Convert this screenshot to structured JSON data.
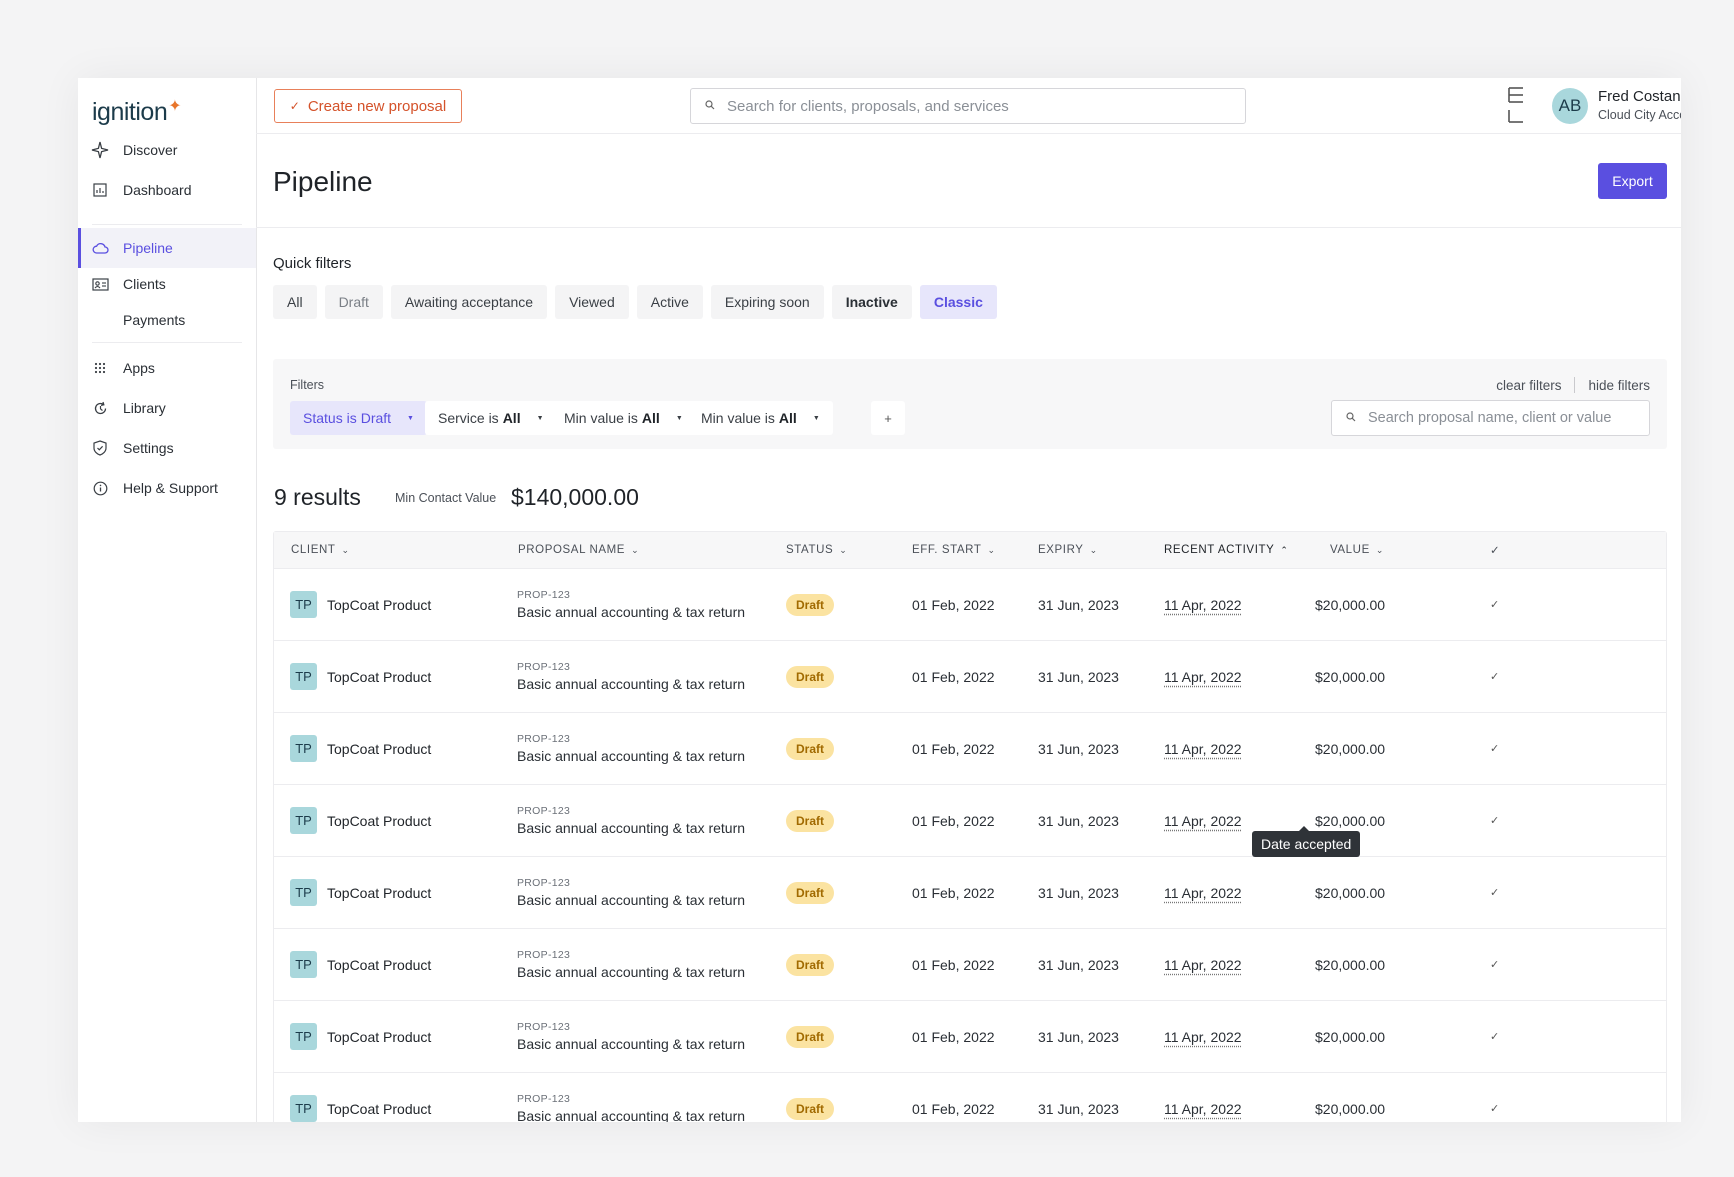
{
  "sidebar": {
    "logo_text": "ignition",
    "items": [
      {
        "label": "Discover",
        "icon": "sparkle-icon"
      },
      {
        "label": "Dashboard",
        "icon": "chart-icon"
      },
      {
        "label": "Pipeline",
        "icon": "cloud-icon",
        "active": true
      },
      {
        "label": "Clients",
        "icon": "id-card-icon"
      },
      {
        "label": "Payments",
        "icon": ""
      },
      {
        "label": "Apps",
        "icon": "grid-icon"
      },
      {
        "label": "Library",
        "icon": "refresh-icon"
      },
      {
        "label": "Settings",
        "icon": "shield-icon"
      },
      {
        "label": "Help & Support",
        "icon": "info-icon"
      }
    ]
  },
  "topbar": {
    "create_label": "Create new proposal",
    "search_placeholder": "Search for clients, proposals, and services",
    "user": {
      "initials": "AB",
      "name": "Fred Costanza",
      "org": "Cloud City Accounting"
    }
  },
  "page": {
    "title": "Pipeline",
    "export_label": "Export"
  },
  "quick_filters": {
    "label": "Quick filters",
    "items": [
      "All",
      "Draft",
      "Awaiting acceptance",
      "Viewed",
      "Active",
      "Expiring soon",
      "Inactive",
      "Classic"
    ],
    "selected": "Classic"
  },
  "filters": {
    "label": "Filters",
    "clear_label": "clear filters",
    "hide_label": "hide filters",
    "search_placeholder": "Search proposal name, client or value",
    "chips": [
      {
        "prefix": "Status is",
        "value": "Draft",
        "active": true
      },
      {
        "prefix": "Service is",
        "value": "All"
      },
      {
        "prefix": "Min value is",
        "value": "All"
      },
      {
        "prefix": "Min value is",
        "value": "All"
      }
    ],
    "add_label": "+"
  },
  "results": {
    "count_label": "9 results",
    "min_label": "Min Contact Value",
    "min_value": "$140,000.00"
  },
  "table": {
    "columns": [
      "CLIENT",
      "PROPOSAL NAME",
      "STATUS",
      "EFF. START",
      "EXPIRY",
      "RECENT ACTIVITY",
      "VALUE"
    ],
    "rows": [
      {
        "initials": "TP",
        "client": "TopCoat Product",
        "prop_id": "PROP-123",
        "prop_name": "Basic annual accounting & tax return",
        "status": "Draft",
        "eff_start": "01 Feb, 2022",
        "expiry": "31 Jun, 2023",
        "recent": "11 Apr, 2022",
        "value": "$20,000.00"
      },
      {
        "initials": "TP",
        "client": "TopCoat Product",
        "prop_id": "PROP-123",
        "prop_name": "Basic annual accounting & tax return",
        "status": "Draft",
        "eff_start": "01 Feb, 2022",
        "expiry": "31 Jun, 2023",
        "recent": "11 Apr, 2022",
        "value": "$20,000.00"
      },
      {
        "initials": "TP",
        "client": "TopCoat Product",
        "prop_id": "PROP-123",
        "prop_name": "Basic annual accounting & tax return",
        "status": "Draft",
        "eff_start": "01 Feb, 2022",
        "expiry": "31 Jun, 2023",
        "recent": "11 Apr, 2022",
        "value": "$20,000.00"
      },
      {
        "initials": "TP",
        "client": "TopCoat Product",
        "prop_id": "PROP-123",
        "prop_name": "Basic annual accounting & tax return",
        "status": "Draft",
        "eff_start": "01 Feb, 2022",
        "expiry": "31 Jun, 2023",
        "recent": "11 Apr, 2022",
        "value": "$20,000.00"
      },
      {
        "initials": "TP",
        "client": "TopCoat Product",
        "prop_id": "PROP-123",
        "prop_name": "Basic annual accounting & tax return",
        "status": "Draft",
        "eff_start": "01 Feb, 2022",
        "expiry": "31 Jun, 2023",
        "recent": "11 Apr, 2022",
        "value": "$20,000.00"
      },
      {
        "initials": "TP",
        "client": "TopCoat Product",
        "prop_id": "PROP-123",
        "prop_name": "Basic annual accounting & tax return",
        "status": "Draft",
        "eff_start": "01 Feb, 2022",
        "expiry": "31 Jun, 2023",
        "recent": "11 Apr, 2022",
        "value": "$20,000.00"
      },
      {
        "initials": "TP",
        "client": "TopCoat Product",
        "prop_id": "PROP-123",
        "prop_name": "Basic annual accounting & tax return",
        "status": "Draft",
        "eff_start": "01 Feb, 2022",
        "expiry": "31 Jun, 2023",
        "recent": "11 Apr, 2022",
        "value": "$20,000.00"
      },
      {
        "initials": "TP",
        "client": "TopCoat Product",
        "prop_id": "PROP-123",
        "prop_name": "Basic annual accounting & tax return",
        "status": "Draft",
        "eff_start": "01 Feb, 2022",
        "expiry": "31 Jun, 2023",
        "recent": "11 Apr, 2022",
        "value": "$20,000.00"
      }
    ],
    "tooltip": "Date accepted"
  },
  "colors": {
    "accent": "#5a4fe0",
    "brand_orange": "#e8752a",
    "draft_badge": "#fbe3a1",
    "avatar": "#a9d7dc"
  }
}
